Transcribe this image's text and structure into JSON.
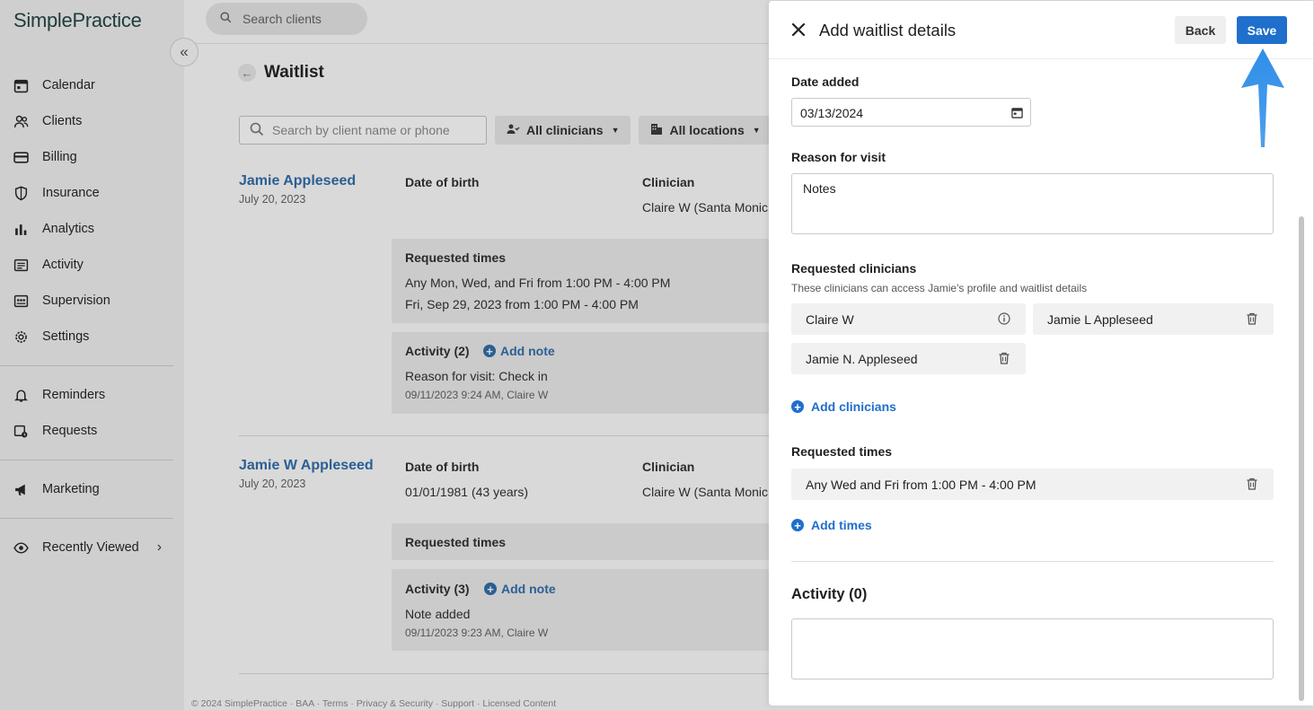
{
  "app": {
    "logo": "SimplePractice"
  },
  "sidebar": {
    "items": [
      {
        "label": "Calendar",
        "icon": "calendar-icon"
      },
      {
        "label": "Clients",
        "icon": "clients-icon"
      },
      {
        "label": "Billing",
        "icon": "billing-icon"
      },
      {
        "label": "Insurance",
        "icon": "shield-icon"
      },
      {
        "label": "Analytics",
        "icon": "analytics-icon"
      },
      {
        "label": "Activity",
        "icon": "activity-icon"
      },
      {
        "label": "Supervision",
        "icon": "supervision-icon"
      },
      {
        "label": "Settings",
        "icon": "gear-icon"
      }
    ],
    "secondary": [
      {
        "label": "Reminders",
        "icon": "bell-icon"
      },
      {
        "label": "Requests",
        "icon": "requests-icon"
      }
    ],
    "marketing": {
      "label": "Marketing",
      "icon": "megaphone-icon"
    },
    "recently_viewed": {
      "label": "Recently Viewed",
      "icon": "eye-icon"
    }
  },
  "topbar": {
    "search_placeholder": "Search clients"
  },
  "page": {
    "title": "Waitlist",
    "search_placeholder": "Search by client name or phone",
    "filter_clinicians": "All clinicians",
    "filter_locations": "All locations"
  },
  "clients": [
    {
      "name": "Jamie Appleseed",
      "date": "July 20, 2023",
      "dob_label": "Date of birth",
      "dob_value": "",
      "clinician_label": "Clinician",
      "clinician_value": "Claire W (Santa Monic",
      "requested_times_label": "Requested times",
      "times": [
        "Any Mon, Wed, and Fri from 1:00 PM - 4:00 PM",
        "Fri, Sep 29, 2023 from 1:00 PM - 4:00 PM"
      ],
      "activity_label": "Activity (2)",
      "add_note": "Add note",
      "activity_text": "Reason for visit: Check in",
      "activity_meta": "09/11/2023 9:24 AM, Claire W"
    },
    {
      "name": "Jamie W Appleseed",
      "date": "July 20, 2023",
      "dob_label": "Date of birth",
      "dob_value": "01/01/1981 (43 years)",
      "clinician_label": "Clinician",
      "clinician_value": "Claire W (Santa Monic",
      "requested_times_label": "Requested times",
      "times": [],
      "activity_label": "Activity (3)",
      "add_note": "Add note",
      "activity_text": "Note added",
      "activity_meta": "09/11/2023 9:23 AM, Claire W"
    }
  ],
  "footer": "© 2024 SimplePractice · BAA · Terms · Privacy & Security · Support · Licensed Content",
  "drawer": {
    "title": "Add waitlist details",
    "back_label": "Back",
    "save_label": "Save",
    "date_added_label": "Date added",
    "date_added_value": "03/13/2024",
    "reason_label": "Reason for visit",
    "reason_value": "Notes",
    "requested_clinicians_label": "Requested clinicians",
    "requested_clinicians_help": "These clinicians can access Jamie's profile and waitlist details",
    "clinicians": [
      "Claire W",
      "Jamie L Appleseed",
      "Jamie N. Appleseed"
    ],
    "add_clinicians": "Add clinicians",
    "requested_times_label": "Requested times",
    "times": [
      "Any Wed and Fri from 1:00 PM - 4:00 PM"
    ],
    "add_times": "Add times",
    "activity_title": "Activity (0)",
    "activity_value": ""
  },
  "colors": {
    "accent": "#1f6fcc",
    "link_dim": "#2b5f94",
    "annotation_arrow": "#2f8fe8"
  }
}
